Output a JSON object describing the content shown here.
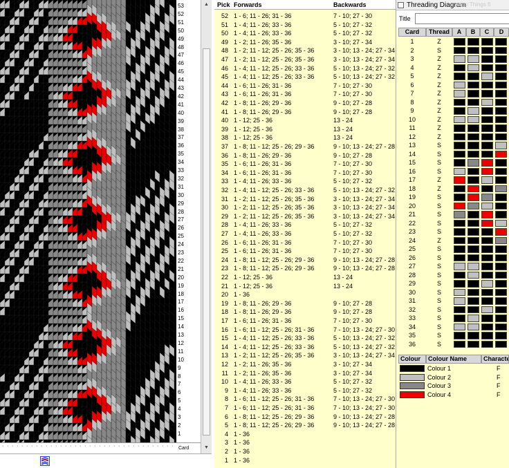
{
  "colors": {
    "black": "#000000",
    "red": "#ee0000",
    "gray": "#888888",
    "lightgray": "#c0c0c0"
  },
  "pattern_view": {
    "row_numbers": [
      "53",
      "52",
      "51",
      "50",
      "49",
      "48",
      "47",
      "46",
      "45",
      "44",
      "43",
      "42",
      "41",
      "40",
      "39",
      "38",
      "37",
      "36",
      "35",
      "34",
      "33",
      "32",
      "31",
      "30",
      "29",
      "28",
      "27",
      "26",
      "25",
      "24",
      "23",
      "22",
      "21",
      "20",
      "19",
      "18",
      "17",
      "16",
      "15",
      "14",
      "13",
      "12",
      "11",
      "10",
      "9",
      "8",
      "7",
      "6",
      "5",
      "4",
      "3",
      "2",
      "1"
    ],
    "card_axis_label": "Card"
  },
  "pick_table": {
    "headers": {
      "pick": "Pick",
      "forwards": "Forwards",
      "backwards": "Backwards"
    },
    "rows": [
      {
        "pick": "52",
        "fwd": "1 - 6; 11 - 26; 31 - 36",
        "bwd": "7 - 10; 27 - 30"
      },
      {
        "pick": "51",
        "fwd": "1 - 4; 11 - 26; 33 - 36",
        "bwd": "5 - 10; 27 - 32"
      },
      {
        "pick": "50",
        "fwd": "1 - 4; 11 - 26; 33 - 36",
        "bwd": "5 - 10; 27 - 32"
      },
      {
        "pick": "49",
        "fwd": "1 - 2; 11 - 26; 35 - 36",
        "bwd": "3 - 10; 27 - 34"
      },
      {
        "pick": "48",
        "fwd": "1 - 2; 11 - 12; 25 - 26; 35 - 36",
        "bwd": "3 - 10; 13 - 24; 27 - 34"
      },
      {
        "pick": "47",
        "fwd": "1 - 2; 11 - 12; 25 - 26; 35 - 36",
        "bwd": "3 - 10; 13 - 24; 27 - 34"
      },
      {
        "pick": "46",
        "fwd": "1 - 4; 11 - 12; 25 - 26; 33 - 36",
        "bwd": "5 - 10; 13 - 24; 27 - 32"
      },
      {
        "pick": "45",
        "fwd": "1 - 4; 11 - 12; 25 - 26; 33 - 36",
        "bwd": "5 - 10; 13 - 24; 27 - 32"
      },
      {
        "pick": "44",
        "fwd": "1 - 6; 11 - 26; 31 - 36",
        "bwd": "7 - 10; 27 - 30"
      },
      {
        "pick": "43",
        "fwd": "1 - 6; 11 - 26; 31 - 36",
        "bwd": "7 - 10; 27 - 30"
      },
      {
        "pick": "42",
        "fwd": "1 - 8; 11 - 26; 29 - 36",
        "bwd": "9 - 10; 27 - 28"
      },
      {
        "pick": "41",
        "fwd": "1 - 8; 11 - 26; 29 - 36",
        "bwd": "9 - 10; 27 - 28"
      },
      {
        "pick": "40",
        "fwd": "1 - 12; 25 - 36",
        "bwd": "13 - 24"
      },
      {
        "pick": "39",
        "fwd": "1 - 12; 25 - 36",
        "bwd": "13 - 24"
      },
      {
        "pick": "38",
        "fwd": "1 - 12; 25 - 36",
        "bwd": "13 - 24"
      },
      {
        "pick": "37",
        "fwd": "1 - 8; 11 - 12; 25 - 26; 29 - 36",
        "bwd": "9 - 10; 13 - 24; 27 - 28"
      },
      {
        "pick": "36",
        "fwd": "1 - 8; 11 - 26; 29 - 36",
        "bwd": "9 - 10; 27 - 28"
      },
      {
        "pick": "35",
        "fwd": "1 - 6; 11 - 26; 31 - 36",
        "bwd": "7 - 10; 27 - 30"
      },
      {
        "pick": "34",
        "fwd": "1 - 6; 11 - 26; 31 - 36",
        "bwd": "7 - 10; 27 - 30"
      },
      {
        "pick": "33",
        "fwd": "1 - 4; 11 - 26; 33 - 36",
        "bwd": "5 - 10; 27 - 32"
      },
      {
        "pick": "32",
        "fwd": "1 - 4; 11 - 12; 25 - 26; 33 - 36",
        "bwd": "5 - 10; 13 - 24; 27 - 32"
      },
      {
        "pick": "31",
        "fwd": "1 - 2; 11 - 12; 25 - 26; 35 - 36",
        "bwd": "3 - 10; 13 - 24; 27 - 34"
      },
      {
        "pick": "30",
        "fwd": "1 - 2; 11 - 12; 25 - 26; 35 - 36",
        "bwd": "3 - 10; 13 - 24; 27 - 34"
      },
      {
        "pick": "29",
        "fwd": "1 - 2; 11 - 12; 25 - 26; 35 - 36",
        "bwd": "3 - 10; 13 - 24; 27 - 34"
      },
      {
        "pick": "28",
        "fwd": "1 - 4; 11 - 26; 33 - 36",
        "bwd": "5 - 10; 27 - 32"
      },
      {
        "pick": "27",
        "fwd": "1 - 4; 11 - 26; 33 - 36",
        "bwd": "5 - 10; 27 - 32"
      },
      {
        "pick": "26",
        "fwd": "1 - 6; 11 - 26; 31 - 36",
        "bwd": "7 - 10; 27 - 30"
      },
      {
        "pick": "25",
        "fwd": "1 - 6; 11 - 26; 31 - 36",
        "bwd": "7 - 10; 27 - 30"
      },
      {
        "pick": "24",
        "fwd": "1 - 8; 11 - 12; 25 - 26; 29 - 36",
        "bwd": "9 - 10; 13 - 24; 27 - 28"
      },
      {
        "pick": "23",
        "fwd": "1 - 8; 11 - 12; 25 - 26; 29 - 36",
        "bwd": "9 - 10; 13 - 24; 27 - 28"
      },
      {
        "pick": "22",
        "fwd": "1 - 12; 25 - 36",
        "bwd": "13 - 24"
      },
      {
        "pick": "21",
        "fwd": "1 - 12; 25 - 36",
        "bwd": "13 - 24"
      },
      {
        "pick": "20",
        "fwd": "1 - 36",
        "bwd": ""
      },
      {
        "pick": "19",
        "fwd": "1 - 8; 11 - 26; 29 - 36",
        "bwd": "9 - 10; 27 - 28"
      },
      {
        "pick": "18",
        "fwd": "1 - 8; 11 - 26; 29 - 36",
        "bwd": "9 - 10; 27 - 28"
      },
      {
        "pick": "17",
        "fwd": "1 - 6; 11 - 26; 31 - 36",
        "bwd": "7 - 10; 27 - 30"
      },
      {
        "pick": "16",
        "fwd": "1 - 6; 11 - 12; 25 - 26; 31 - 36",
        "bwd": "7 - 10; 13 - 24; 27 - 30"
      },
      {
        "pick": "15",
        "fwd": "1 - 4; 11 - 12; 25 - 26; 33 - 36",
        "bwd": "5 - 10; 13 - 24; 27 - 32"
      },
      {
        "pick": "14",
        "fwd": "1 - 4; 11 - 12; 25 - 26; 33 - 36",
        "bwd": "5 - 10; 13 - 24; 27 - 32"
      },
      {
        "pick": "13",
        "fwd": "1 - 2; 11 - 12; 25 - 26; 35 - 36",
        "bwd": "3 - 10; 13 - 24; 27 - 34"
      },
      {
        "pick": "12",
        "fwd": "1 - 2; 11 - 26; 35 - 36",
        "bwd": "3 - 10; 27 - 34"
      },
      {
        "pick": "11",
        "fwd": "1 - 2; 11 - 26; 35 - 36",
        "bwd": "3 - 10; 27 - 34"
      },
      {
        "pick": "10",
        "fwd": "1 - 4; 11 - 26; 33 - 36",
        "bwd": "5 - 10; 27 - 32"
      },
      {
        "pick": "9",
        "fwd": "1 - 4; 11 - 26; 33 - 36",
        "bwd": "5 - 10; 27 - 32"
      },
      {
        "pick": "8",
        "fwd": "1 - 6; 11 - 12; 25 - 26; 31 - 36",
        "bwd": "7 - 10; 13 - 24; 27 - 30"
      },
      {
        "pick": "7",
        "fwd": "1 - 6; 11 - 12; 25 - 26; 31 - 36",
        "bwd": "7 - 10; 13 - 24; 27 - 30"
      },
      {
        "pick": "6",
        "fwd": "1 - 8; 11 - 12; 25 - 26; 29 - 36",
        "bwd": "9 - 10; 13 - 24; 27 - 28"
      },
      {
        "pick": "5",
        "fwd": "1 - 8; 11 - 12; 25 - 26; 29 - 36",
        "bwd": "9 - 10; 13 - 24; 27 - 28"
      },
      {
        "pick": "4",
        "fwd": "1 - 36",
        "bwd": ""
      },
      {
        "pick": "3",
        "fwd": "1 - 36",
        "bwd": ""
      },
      {
        "pick": "2",
        "fwd": "1 - 36",
        "bwd": ""
      },
      {
        "pick": "1",
        "fwd": "1 - 36",
        "bwd": ""
      }
    ]
  },
  "threading": {
    "window_title": "Threading Diagram",
    "window_title_faded": "sorry Things fi",
    "title_label": "Title",
    "title_value": "",
    "headers": {
      "card": "Card",
      "thread": "Thread",
      "a": "A",
      "b": "B",
      "c": "C",
      "d": "D"
    },
    "rows": [
      {
        "card": "1",
        "thread": "Z",
        "cells": [
          "black",
          "black",
          "black",
          "black"
        ]
      },
      {
        "card": "2",
        "thread": "S",
        "cells": [
          "black",
          "black",
          "black",
          "black"
        ]
      },
      {
        "card": "3",
        "thread": "Z",
        "cells": [
          "lightgray",
          "lightgray",
          "black",
          "black"
        ]
      },
      {
        "card": "4",
        "thread": "Z",
        "cells": [
          "black",
          "lightgray",
          "black",
          "black"
        ]
      },
      {
        "card": "5",
        "thread": "Z",
        "cells": [
          "black",
          "black",
          "lightgray",
          "black"
        ]
      },
      {
        "card": "6",
        "thread": "Z",
        "cells": [
          "lightgray",
          "black",
          "black",
          "black"
        ]
      },
      {
        "card": "7",
        "thread": "Z",
        "cells": [
          "lightgray",
          "black",
          "black",
          "black"
        ]
      },
      {
        "card": "8",
        "thread": "Z",
        "cells": [
          "black",
          "black",
          "lightgray",
          "black"
        ]
      },
      {
        "card": "9",
        "thread": "Z",
        "cells": [
          "black",
          "lightgray",
          "black",
          "black"
        ]
      },
      {
        "card": "10",
        "thread": "Z",
        "cells": [
          "lightgray",
          "lightgray",
          "black",
          "black"
        ]
      },
      {
        "card": "11",
        "thread": "Z",
        "cells": [
          "black",
          "black",
          "black",
          "black"
        ]
      },
      {
        "card": "12",
        "thread": "Z",
        "cells": [
          "black",
          "black",
          "black",
          "black"
        ]
      },
      {
        "card": "13",
        "thread": "S",
        "cells": [
          "black",
          "black",
          "black",
          "lightgray"
        ]
      },
      {
        "card": "14",
        "thread": "S",
        "cells": [
          "black",
          "black",
          "black",
          "red"
        ]
      },
      {
        "card": "15",
        "thread": "S",
        "cells": [
          "black",
          "gray",
          "red",
          "black"
        ]
      },
      {
        "card": "16",
        "thread": "S",
        "cells": [
          "lightgray",
          "black",
          "red",
          "black"
        ]
      },
      {
        "card": "17",
        "thread": "Z",
        "cells": [
          "red",
          "black",
          "lightgray",
          "black"
        ]
      },
      {
        "card": "18",
        "thread": "Z",
        "cells": [
          "black",
          "red",
          "black",
          "gray"
        ]
      },
      {
        "card": "19",
        "thread": "S",
        "cells": [
          "black",
          "red",
          "gray",
          "black"
        ]
      },
      {
        "card": "20",
        "thread": "S",
        "cells": [
          "red",
          "gray",
          "lightgray",
          "black"
        ]
      },
      {
        "card": "21",
        "thread": "S",
        "cells": [
          "gray",
          "black",
          "red",
          "black"
        ]
      },
      {
        "card": "22",
        "thread": "S",
        "cells": [
          "black",
          "black",
          "red",
          "lightgray"
        ]
      },
      {
        "card": "23",
        "thread": "S",
        "cells": [
          "black",
          "black",
          "black",
          "red"
        ]
      },
      {
        "card": "24",
        "thread": "Z",
        "cells": [
          "black",
          "black",
          "black",
          "gray"
        ]
      },
      {
        "card": "25",
        "thread": "S",
        "cells": [
          "black",
          "black",
          "black",
          "black"
        ]
      },
      {
        "card": "26",
        "thread": "S",
        "cells": [
          "black",
          "black",
          "black",
          "black"
        ]
      },
      {
        "card": "27",
        "thread": "S",
        "cells": [
          "lightgray",
          "lightgray",
          "black",
          "black"
        ]
      },
      {
        "card": "28",
        "thread": "S",
        "cells": [
          "black",
          "lightgray",
          "black",
          "black"
        ]
      },
      {
        "card": "29",
        "thread": "S",
        "cells": [
          "black",
          "black",
          "lightgray",
          "black"
        ]
      },
      {
        "card": "30",
        "thread": "S",
        "cells": [
          "lightgray",
          "black",
          "black",
          "black"
        ]
      },
      {
        "card": "31",
        "thread": "S",
        "cells": [
          "lightgray",
          "black",
          "black",
          "black"
        ]
      },
      {
        "card": "32",
        "thread": "S",
        "cells": [
          "black",
          "black",
          "lightgray",
          "black"
        ]
      },
      {
        "card": "33",
        "thread": "S",
        "cells": [
          "black",
          "lightgray",
          "black",
          "black"
        ]
      },
      {
        "card": "34",
        "thread": "S",
        "cells": [
          "lightgray",
          "lightgray",
          "black",
          "black"
        ]
      },
      {
        "card": "35",
        "thread": "S",
        "cells": [
          "black",
          "black",
          "black",
          "black"
        ]
      },
      {
        "card": "36",
        "thread": "S",
        "cells": [
          "black",
          "black",
          "black",
          "black"
        ]
      }
    ]
  },
  "colour_table": {
    "headers": {
      "colour": "Colour",
      "name": "Colour Name",
      "char": "Characte"
    },
    "rows": [
      {
        "swatch": "#000000",
        "name": "Colour 1",
        "char": "F"
      },
      {
        "swatch": "#c0c0c0",
        "name": "Colour 2",
        "char": "F"
      },
      {
        "swatch": "#888888",
        "name": "Colour 3",
        "char": "F"
      },
      {
        "swatch": "#ee0000",
        "name": "Colour 4",
        "char": "F"
      }
    ]
  }
}
